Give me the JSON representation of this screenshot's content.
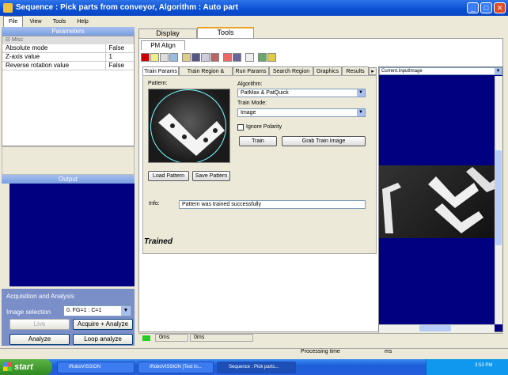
{
  "window": {
    "title": "Sequence : Pick parts from conveyor, Algorithm : Auto part"
  },
  "menu": [
    "File",
    "View",
    "Tools",
    "Help"
  ],
  "params": {
    "header": "Parameters",
    "category": "Misc",
    "rows": [
      {
        "name": "Absolute mode",
        "value": "False"
      },
      {
        "name": "Z-axis value",
        "value": "1"
      },
      {
        "name": "Reverse rotation value",
        "value": "False"
      }
    ]
  },
  "output": {
    "header": "Output"
  },
  "acq": {
    "title": "Acquisition and Analysis",
    "image_selection_label": "Image selection",
    "image_selection_value": "0. FG=1 : C=1",
    "live": "Live",
    "acquire_analyze": "Acquire + Analyze",
    "analyze": "Analyze",
    "loop": "Loop analyze"
  },
  "tabs": {
    "display": "Display",
    "tools": "Tools",
    "pm": "PM Align"
  },
  "subtabs": [
    "Train Params",
    "Train Region & Origin",
    "Run Params",
    "Search Region",
    "Graphics",
    "Results"
  ],
  "train": {
    "pattern_label": "Pattern:",
    "algorithm_label": "Algorithm:",
    "algorithm_value": "PatMax & PatQuick",
    "mode_label": "Train Mode:",
    "mode_value": "Image",
    "ignore_polarity": "Ignore Polarity",
    "train_btn": "Train",
    "grab_btn": "Grab Train Image",
    "load_btn": "Load Pattern",
    "save_btn": "Save Pattern",
    "info_label": "Info:",
    "info_value": "Pattern was trained successfully",
    "status": "Trained"
  },
  "image": {
    "source": "Current.InputImage"
  },
  "status": {
    "a": "0ms",
    "b": "0ms",
    "processing_label": "Processing time",
    "processing_unit": "ms"
  },
  "taskbar": {
    "start": "start",
    "tasks": [
      "iRoboVISSION",
      "iRoboVISSION [Test in...",
      "Sequence : Pick parts..."
    ],
    "clock": "3:53 PM"
  }
}
